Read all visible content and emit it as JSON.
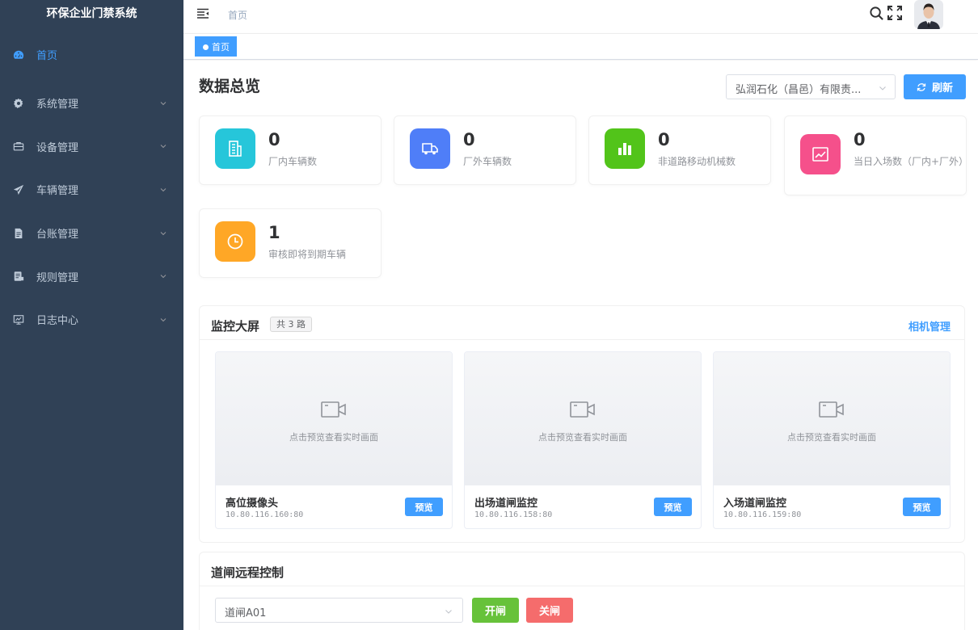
{
  "app": {
    "title": "环保企业门禁系统"
  },
  "sidebar": {
    "items": [
      {
        "label": "首页",
        "icon": "dashboard-icon",
        "active": true
      },
      {
        "label": "系统管理",
        "icon": "gear-icon"
      },
      {
        "label": "设备管理",
        "icon": "briefcase-icon"
      },
      {
        "label": "车辆管理",
        "icon": "send-icon"
      },
      {
        "label": "台账管理",
        "icon": "document-icon"
      },
      {
        "label": "规则管理",
        "icon": "rules-icon"
      },
      {
        "label": "日志中心",
        "icon": "monitor-icon"
      }
    ]
  },
  "navbar": {
    "breadcrumb": "首页"
  },
  "tags": {
    "active": "首页"
  },
  "overview": {
    "title": "数据总览",
    "company": "弘润石化（昌邑）有限责...",
    "refresh_label": "刷新",
    "stats": [
      {
        "value": "0",
        "label": "厂内车辆数",
        "color": "#26c6da"
      },
      {
        "value": "0",
        "label": "厂外车辆数",
        "color": "#4f7ef8"
      },
      {
        "value": "0",
        "label": "非道路移动机械数",
        "color": "#52c41a"
      },
      {
        "value": "0",
        "label": "当日入场数（厂内+厂外）",
        "color": "#f5508b"
      },
      {
        "value": "1",
        "label": "审核即将到期车辆",
        "color": "#ffa726"
      }
    ]
  },
  "monitor": {
    "title": "监控大屏",
    "count": "共 3 路",
    "link": "相机管理",
    "hint": "点击预览查看实时画面",
    "preview_label": "预览",
    "cameras": [
      {
        "name": "高位摄像头",
        "ip": "10.80.116.160:80"
      },
      {
        "name": "出场道闸监控",
        "ip": "10.80.116.158:80"
      },
      {
        "name": "入场道闸监控",
        "ip": "10.80.116.159:80"
      }
    ]
  },
  "gate": {
    "title": "道闸远程控制",
    "selected": "道闸A01",
    "open_label": "开闸",
    "close_label": "关闸"
  }
}
